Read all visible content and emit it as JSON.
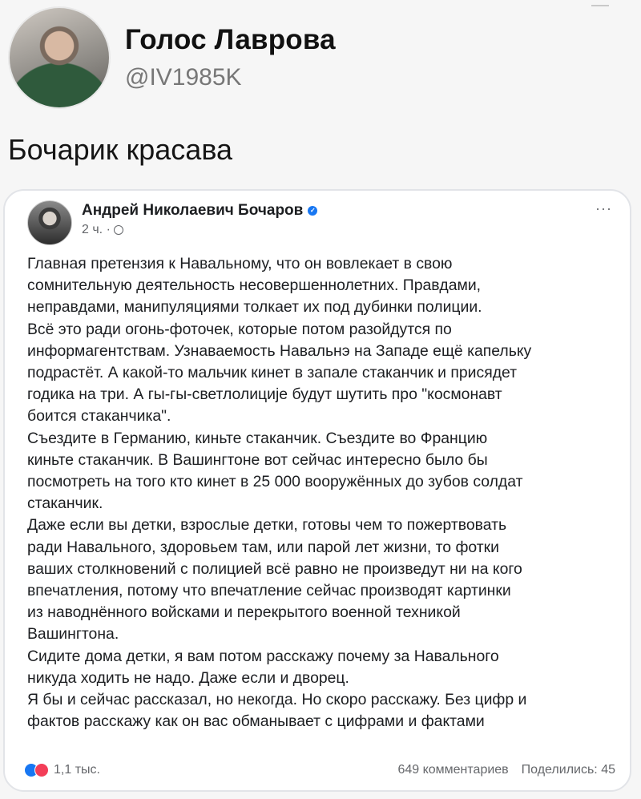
{
  "tweet": {
    "author_name": "Голос Лаврова",
    "handle": "@IV1985K",
    "text": "Бочарик красава"
  },
  "post": {
    "author": "Андрей Николаевич Бочаров",
    "time": "2 ч. ·",
    "lines": [
      "Главная претензия к Навальному, что он вовлекает в свою",
      "сомнительную деятельность несовершеннолетних. Правдами,",
      "неправдами, манипуляциями толкает их под дубинки полиции.",
      "Всё это ради огонь-фоточек, которые потом разойдутся по",
      "информагентствам. Узнаваемость Навальнэ на Западе ещё капельку",
      "подрастёт. А какой-то мальчик кинет в запале стаканчик и присядет",
      "годика на три. А гы-гы-светлолиције будут шутить про \"космонавт",
      "боится стаканчика\".",
      "Съездите в Германию, киньте стаканчик. Съездите во Францию",
      "киньте стаканчик. В Вашингтоне вот сейчас интересно было бы",
      "посмотреть на того кто кинет в 25 000 вооружённых до зубов солдат",
      "стаканчик.",
      "Даже если вы детки, взрослые детки, готовы чем то пожертвовать",
      "ради Навального, здоровьем там, или парой лет жизни, то фотки",
      "ваших столкновений с полицией всё равно не произведут ни на кого",
      "впечатления, потому что впечатление сейчас производят картинки",
      "из наводнённого войсками и перекрытого военной техникой",
      "Вашингтона.",
      "Сидите дома детки, я вам потом расскажу почему за Навального",
      "никуда ходить не надо. Даже если и дворец.",
      "Я бы и сейчас рассказал, но некогда. Но скоро расскажу. Без цифр и",
      "фактов расскажу как он вас обманывает с цифрами и фактами"
    ],
    "reactions_count": "1,1 тыс.",
    "comments": "649 комментариев",
    "shares": "Поделились: 45",
    "more": "···"
  }
}
